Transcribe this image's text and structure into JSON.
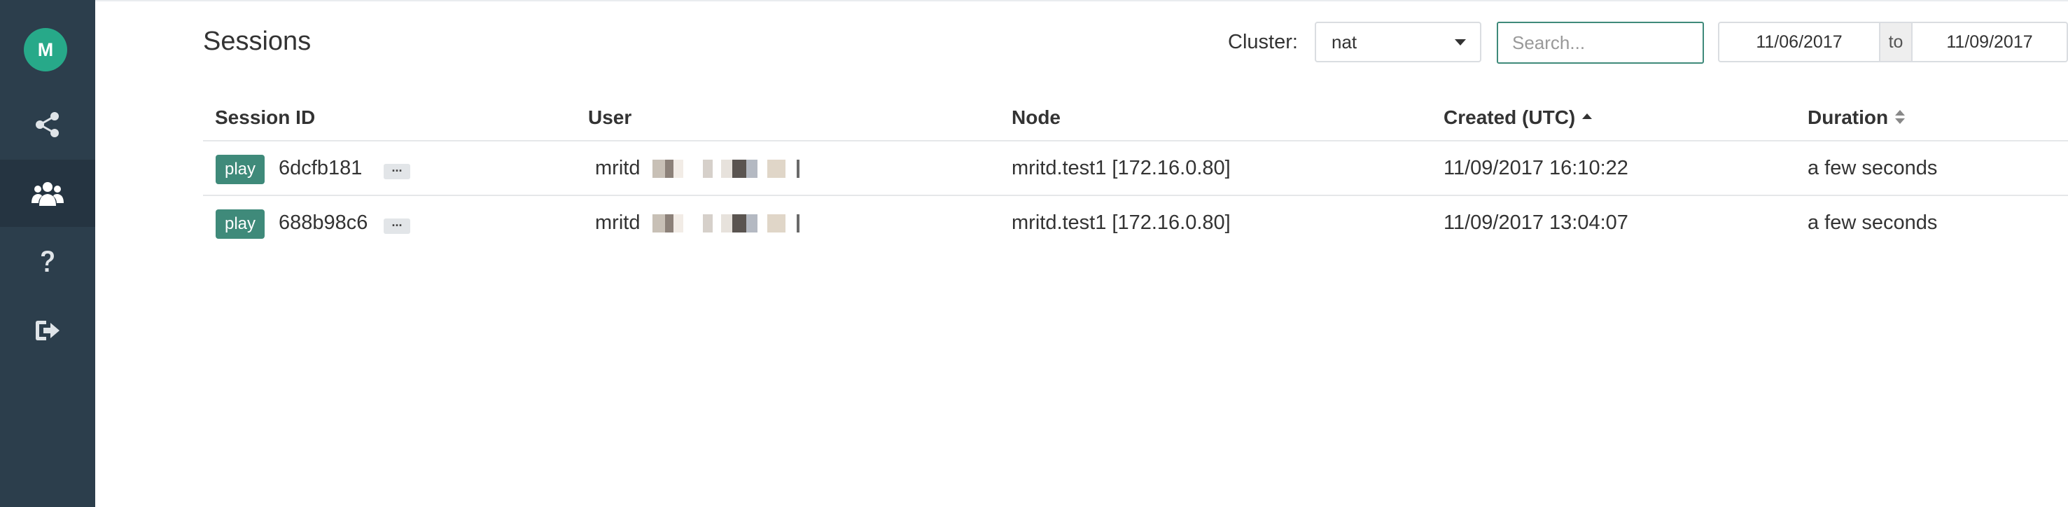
{
  "sidebar": {
    "avatar_initial": "M",
    "items": [
      {
        "name": "share-icon"
      },
      {
        "name": "users-icon"
      },
      {
        "name": "help-icon"
      },
      {
        "name": "logout-icon"
      }
    ],
    "bg_color": "#2c3e4c",
    "accent_color": "#27a989"
  },
  "header": {
    "title": "Sessions",
    "cluster_label": "Cluster:",
    "cluster_value": "nat",
    "search_placeholder": "Search...",
    "date_from": "11/06/2017",
    "date_separator": "to",
    "date_to": "11/09/2017"
  },
  "table": {
    "columns": {
      "session_id": "Session ID",
      "user": "User",
      "node": "Node",
      "created": "Created (UTC)",
      "duration": "Duration"
    },
    "play_label": "play",
    "more_label": "...",
    "rows": [
      {
        "session_id": "6dcfb181",
        "user": "mritd",
        "node": "mritd.test1 [172.16.0.80]",
        "created": "11/09/2017 16:10:22",
        "duration": "a few seconds"
      },
      {
        "session_id": "688b98c6",
        "user": "mritd",
        "node": "mritd.test1 [172.16.0.80]",
        "created": "11/09/2017 13:04:07",
        "duration": "a few seconds"
      }
    ]
  }
}
